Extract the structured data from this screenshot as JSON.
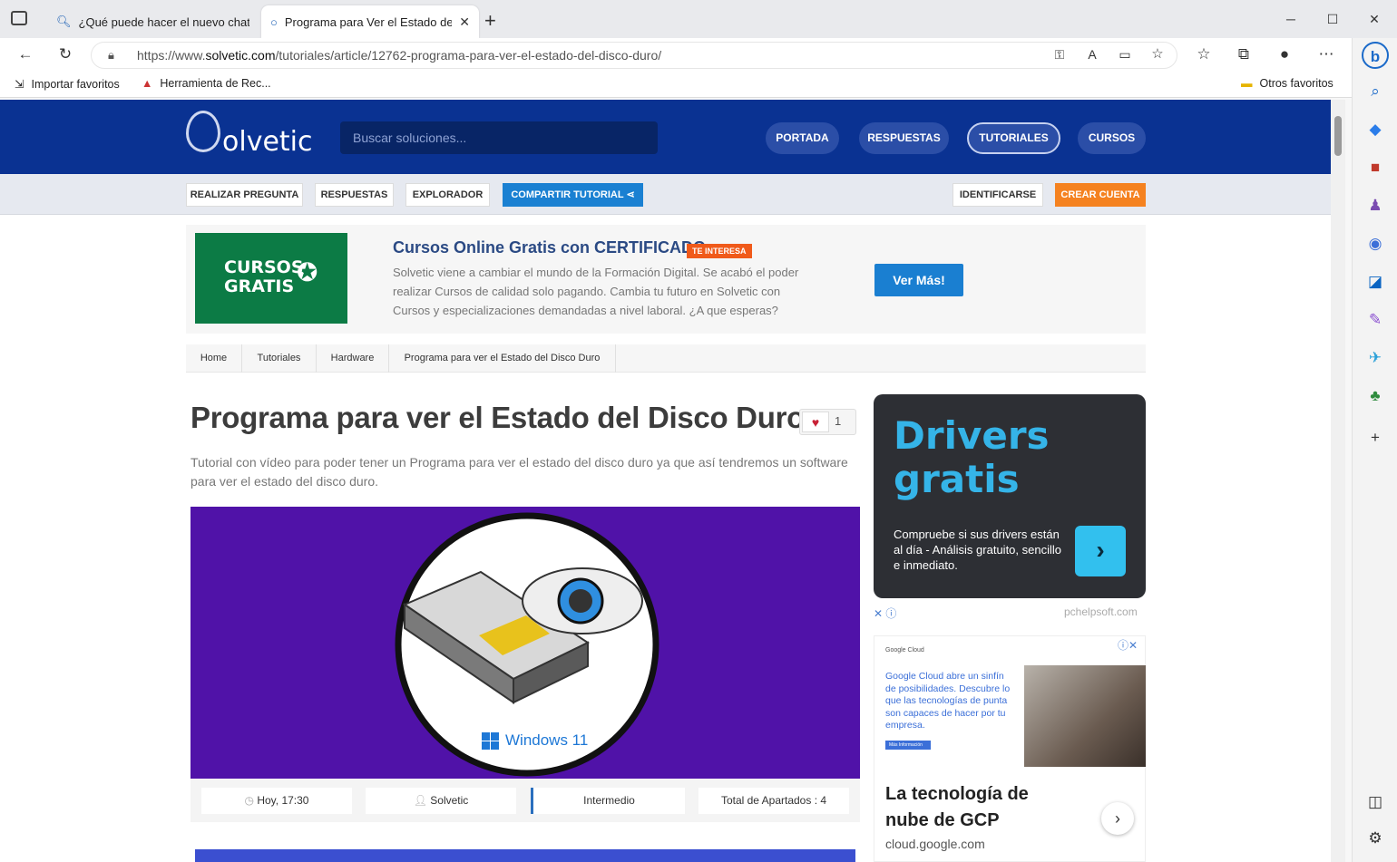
{
  "browser": {
    "tabs": [
      {
        "title": "¿Qué puede hacer el nuevo chat"
      },
      {
        "title": "Programa para Ver el Estado del"
      }
    ],
    "url_prefix": "https://www.",
    "url_domain": "solvetic.com",
    "url_path": "/tutoriales/article/12762-programa-para-ver-el-estado-del-disco-duro/",
    "favorites": [
      "Importar favoritos",
      "Herramienta de Rec...",
      "Otros favoritos"
    ]
  },
  "site": {
    "logo": "olvetic",
    "search_placeholder": "Buscar soluciones...",
    "nav": [
      "PORTADA",
      "RESPUESTAS",
      "TUTORIALES",
      "CURSOS"
    ],
    "subnav": [
      "REALIZAR PREGUNTA",
      "RESPUESTAS",
      "EXPLORADOR",
      "COMPARTIR TUTORIAL",
      "IDENTIFICARSE",
      "CREAR CUENTA"
    ]
  },
  "promo": {
    "image_line1": "CURSOS",
    "image_line2": "GRATIS",
    "title": "Cursos Online Gratis con CERTIFICADO",
    "badge": "TE INTERESA",
    "text": "Solvetic viene a cambiar el mundo de la Formación Digital. Se acabó el poder realizar Cursos de calidad solo pagando. Cambia tu futuro en Solvetic con Cursos y especializaciones demandadas a nivel laboral. ¿A que esperas?",
    "button": "Ver Más!"
  },
  "breadcrumb": [
    "Home",
    "Tutoriales",
    "Hardware",
    "Programa para ver el Estado del Disco Duro"
  ],
  "article": {
    "title": "Programa para ver el Estado del Disco Duro",
    "likes": "1",
    "description": "Tutorial con vídeo para poder tener un Programa para ver el estado del disco duro ya que así tendremos un software para ver el estado del disco duro.",
    "hero_label": "Windows 11",
    "meta": [
      "Hoy, 17:30",
      "Solvetic",
      "Intermedio",
      "Total de Apartados : 4"
    ]
  },
  "ads": {
    "ad1_title": "Drivers gratis",
    "ad1_text": "Compruebe si sus drivers están al día - Análisis gratuito, sencillo e inmediato.",
    "ad1_source": "pchelpsoft.com",
    "ad2_brand": "Google Cloud",
    "ad2_text": "Google Cloud abre un sinfín de posibilidades. Descubre lo que las tecnologías de punta son capaces de hacer por tu empresa.",
    "ad2_cta": "Más Información",
    "ad2_title": "La tecnología de nube de GCP",
    "ad2_domain": "cloud.google.com"
  },
  "colors": {
    "header": "#0a3292",
    "accent_blue": "#1a80d2",
    "accent_orange": "#f58220",
    "promo_green": "#0c7b45"
  }
}
